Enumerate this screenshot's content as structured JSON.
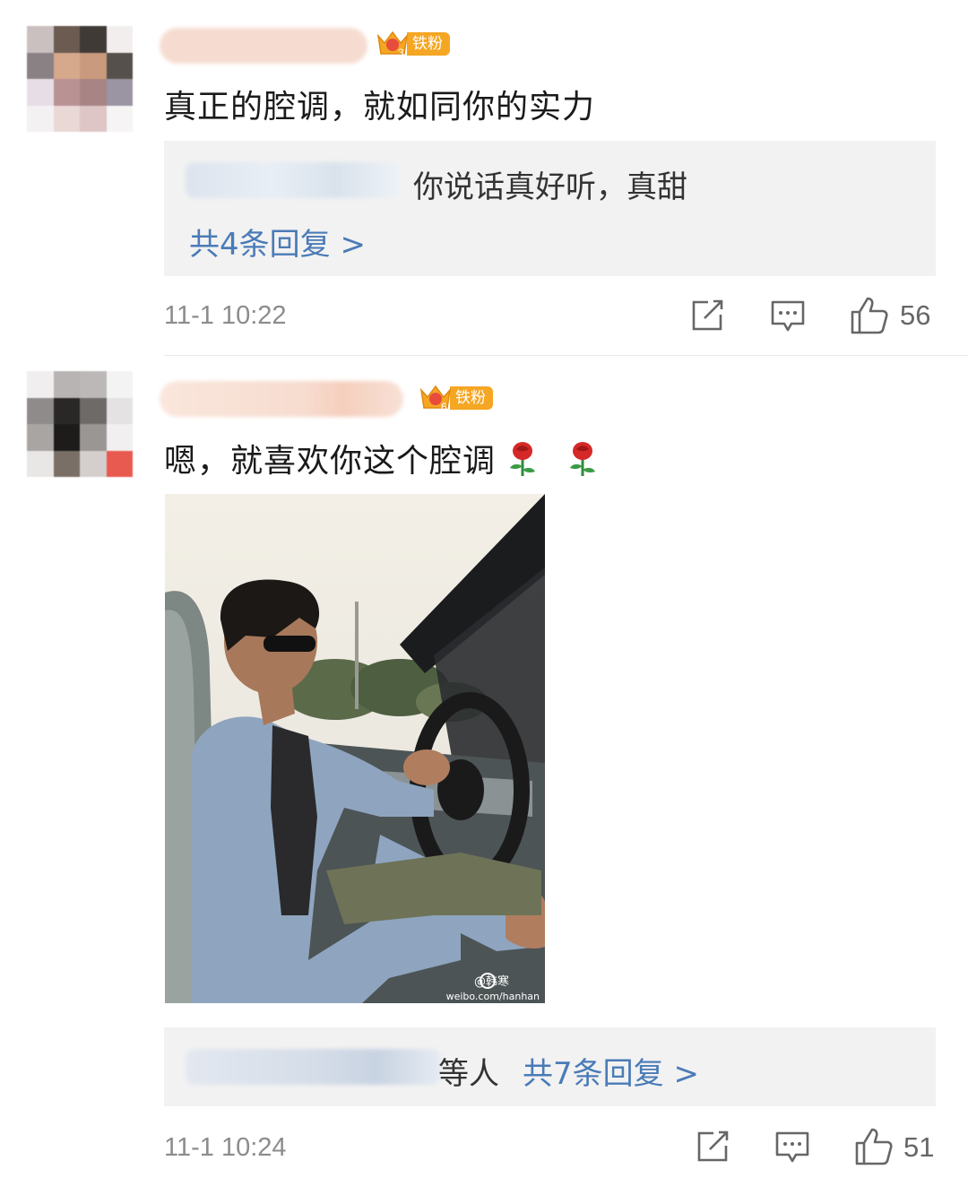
{
  "colors": {
    "badge": "#f5a623",
    "link": "#4a7bb7",
    "meta": "#8c8c8c",
    "reply_bg": "#f2f2f2"
  },
  "comments": [
    {
      "badge_label": "铁粉",
      "badge_level": "3",
      "text": "真正的腔调，就如同你的实力",
      "reply_preview": "你说话真好听，真甜",
      "reply_link": "共4条回复 >",
      "time": "11-1 10:22",
      "like_count": "56"
    },
    {
      "badge_label": "铁粉",
      "badge_level": "6",
      "text": "嗯，就喜欢你这个腔调",
      "emoji": [
        "rose-icon",
        "rose-icon"
      ],
      "image_watermark": "@韩寒",
      "image_watermark_sub": "weibo.com/hanhan",
      "reply_prefix": "等人",
      "reply_link": "共7条回复 >",
      "time": "11-1 10:24",
      "like_count": "51"
    }
  ],
  "icons": [
    "repost-icon",
    "comment-icon",
    "like-icon"
  ]
}
